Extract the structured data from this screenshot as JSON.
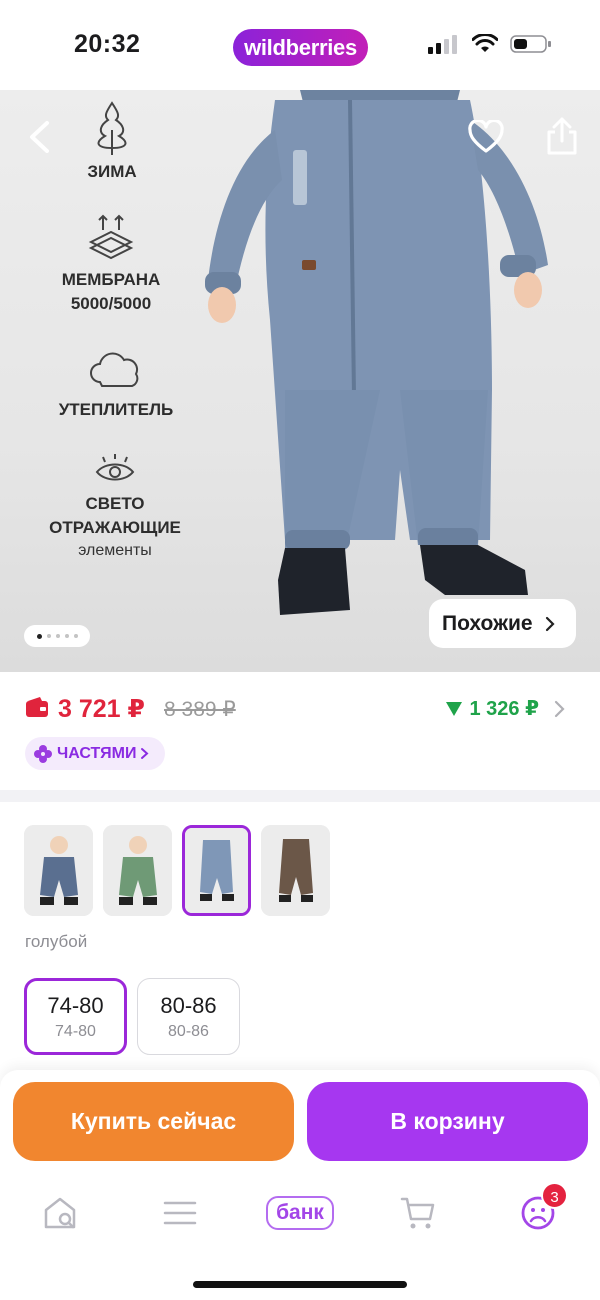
{
  "status_bar": {
    "time": "20:32",
    "brand": "wildberries"
  },
  "hero": {
    "features": [
      {
        "title": "ЗИМА",
        "subtitle": ""
      },
      {
        "title": "МЕМБРАНА\n5000/5000",
        "subtitle": ""
      },
      {
        "title": "УТЕПЛИТЕЛЬ",
        "subtitle": ""
      },
      {
        "title": "СВЕТО\nОТРАЖАЮЩИЕ",
        "subtitle": "элементы"
      }
    ],
    "similar_label": "Похожие",
    "slide_count": 5,
    "active_slide": 1,
    "icons": {
      "back": "chevron-left-icon",
      "favorite": "heart-icon",
      "share": "share-icon"
    }
  },
  "price": {
    "current": "3 721 ₽",
    "old": "8 389 ₽",
    "cashback": "1 326 ₽",
    "installments_label": "ЧАСТЯМИ",
    "colors": {
      "current": "#e0243c",
      "cashback": "#1fa34a",
      "accent": "#9b27d9"
    }
  },
  "variants": {
    "thumbnails": [
      {
        "color": "#5a6f90",
        "selected": false
      },
      {
        "color": "#6f9a76",
        "selected": false
      },
      {
        "color": "#7f97b7",
        "selected": true
      },
      {
        "color": "#6b5748",
        "selected": false
      }
    ],
    "color_label": "голубой",
    "sizes": [
      {
        "main": "74-80",
        "sub": "74-80",
        "selected": true
      },
      {
        "main": "80-86",
        "sub": "80-86",
        "selected": false
      }
    ]
  },
  "actions": {
    "buy_now": "Купить сейчас",
    "to_cart": "В корзину",
    "buy_now_color": "#f1862f",
    "to_cart_color": "#a637f0"
  },
  "tab_bar": {
    "items": [
      "home-search-icon",
      "menu-icon",
      "bank",
      "cart-icon",
      "profile-icon"
    ],
    "bank_label": "банк",
    "profile_badge": "3"
  }
}
